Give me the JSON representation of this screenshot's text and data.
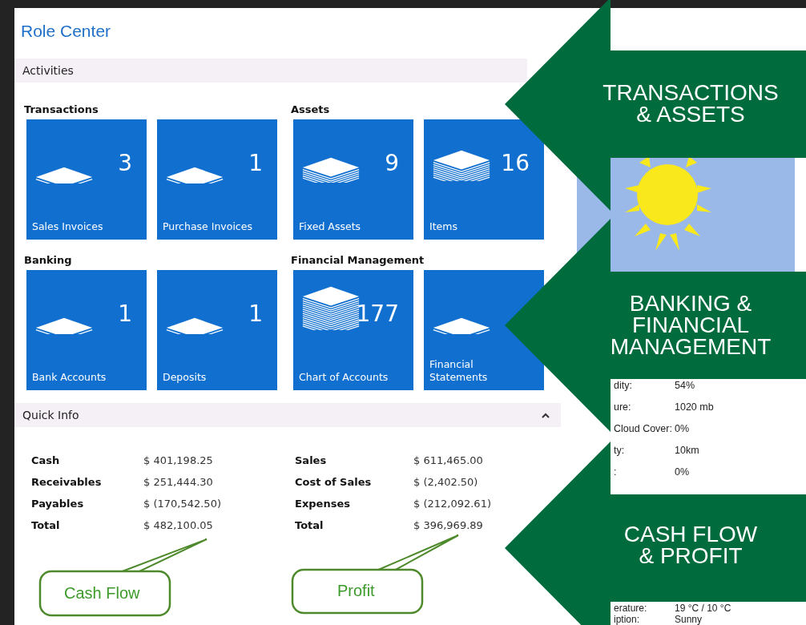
{
  "page": {
    "title": "Role Center"
  },
  "activities": {
    "title": "Activities",
    "groups": [
      {
        "title": "Transactions",
        "tiles": [
          {
            "label": "Sales Invoices",
            "count": "3",
            "kind": "sheet"
          },
          {
            "label": "Purchase Invoices",
            "count": "1",
            "kind": "sheet"
          }
        ]
      },
      {
        "title": "Assets",
        "tiles": [
          {
            "label": "Fixed Assets",
            "count": "9",
            "kind": "small-stack"
          },
          {
            "label": "Items",
            "count": "16",
            "kind": "stack"
          }
        ]
      },
      {
        "title": "Banking",
        "tiles": [
          {
            "label": "Bank Accounts",
            "count": "1",
            "kind": "sheet"
          },
          {
            "label": "Deposits",
            "count": "1",
            "kind": "sheet"
          }
        ]
      },
      {
        "title": "Financial Management",
        "tiles": [
          {
            "label": "Chart of Accounts",
            "count": "177",
            "kind": "tall-stack"
          },
          {
            "label": "Financial\nStatements",
            "kind": "sheet"
          }
        ]
      }
    ]
  },
  "quick_info": {
    "title": "Quick Info",
    "expanded": true,
    "columns": [
      [
        {
          "label": "Cash",
          "value": "$ 401,198.25"
        },
        {
          "label": "Receivables",
          "value": "$ 251,444.30"
        },
        {
          "label": "Payables",
          "value": "$ (170,542.50)"
        },
        {
          "label": "Total",
          "value": "$ 482,100.05"
        }
      ],
      [
        {
          "label": "Sales",
          "value": "$ 611,465.00"
        },
        {
          "label": "Cost of Sales",
          "value": "$ (2,402.50)"
        },
        {
          "label": "Expenses",
          "value": "$ (212,092.61)"
        },
        {
          "label": "Total",
          "value": "$ 396,969.89"
        }
      ]
    ]
  },
  "callouts": [
    {
      "text": "Cash Flow"
    },
    {
      "text": "Profit"
    }
  ],
  "weather": {
    "rows": [
      {
        "label": "dity:",
        "value": "54%"
      },
      {
        "label": "ure:",
        "value": "1020 mb"
      },
      {
        "label": "Cloud Cover:",
        "value": "0%"
      },
      {
        "label": "ty:",
        "value": "10km"
      },
      {
        "label": ":",
        "value": "0%"
      }
    ],
    "rows_lower": [
      {
        "label": "erature:",
        "value": "19 °C / 10 °C"
      },
      {
        "label": "iption:",
        "value": "Sunny"
      }
    ]
  },
  "arrows": [
    {
      "lines": [
        "TRANSACTIONS",
        "& ASSETS"
      ]
    },
    {
      "lines": [
        "BANKING &",
        "FINANCIAL",
        "MANAGEMENT"
      ]
    },
    {
      "lines": [
        "CASH FLOW",
        "& PROFIT"
      ]
    }
  ]
}
